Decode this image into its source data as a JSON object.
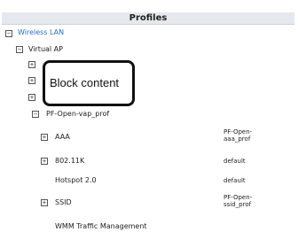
{
  "header": {
    "title": "Profiles"
  },
  "tree": {
    "wireless_lan": {
      "label": "Wireless LAN",
      "toggle": "−"
    },
    "virtual_ap": {
      "label": "Virtual AP",
      "toggle": "−"
    },
    "collapsed_toggles": [
      "+",
      "+",
      "+"
    ],
    "vap_profile": {
      "label": "PF-Open-vap_prof",
      "toggle": "−"
    },
    "children": [
      {
        "label": "AAA",
        "toggle": "+",
        "value_line1": "PF-Open-",
        "value_line2": "aaa_prof"
      },
      {
        "label": "802.11K",
        "toggle": "+",
        "value_line1": "default",
        "value_line2": ""
      },
      {
        "label": "Hotspot 2.0",
        "toggle": "",
        "value_line1": "default",
        "value_line2": ""
      },
      {
        "label": "SSID",
        "toggle": "+",
        "value_line1": "PF-Open-",
        "value_line2": "ssid_prof"
      },
      {
        "label": "WMM Traffic Management",
        "toggle": "",
        "value_line1": "",
        "value_line2": ""
      }
    ]
  },
  "callout": {
    "text": "Block content"
  }
}
